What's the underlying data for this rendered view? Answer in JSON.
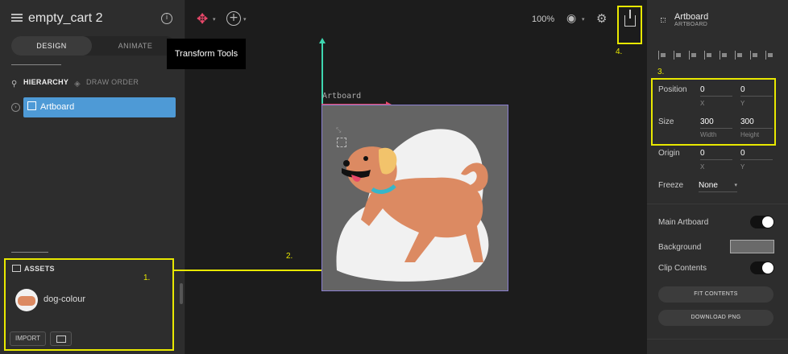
{
  "file": {
    "title": "empty_cart 2"
  },
  "modes": {
    "design": "DESIGN",
    "animate": "ANIMATE"
  },
  "left_tabs": {
    "hierarchy": "HIERARCHY",
    "draw_order": "DRAW ORDER"
  },
  "hierarchy": {
    "items": [
      {
        "label": "Artboard"
      }
    ]
  },
  "assets": {
    "header": "ASSETS",
    "items": [
      {
        "name": "dog-colour"
      }
    ],
    "import_label": "IMPORT"
  },
  "toolbar": {
    "zoom": "100%",
    "tooltip": "Transform Tools"
  },
  "canvas": {
    "artboard_label": "Artboard"
  },
  "annotations": {
    "one": "1.",
    "two": "2.",
    "three": "3.",
    "four": "4.",
    "color": "#e8e800"
  },
  "inspector": {
    "name": "Artboard",
    "type": "ARTBOARD",
    "position": {
      "label": "Position",
      "x": "0",
      "y": "0",
      "x_label": "X",
      "y_label": "Y"
    },
    "size": {
      "label": "Size",
      "width": "300",
      "height": "300",
      "width_label": "Width",
      "height_label": "Height"
    },
    "origin": {
      "label": "Origin",
      "x": "0",
      "y": "0",
      "x_label": "X",
      "y_label": "Y"
    },
    "freeze": {
      "label": "Freeze",
      "value": "None"
    },
    "main_artboard": {
      "label": "Main Artboard",
      "on": true
    },
    "background": {
      "label": "Background",
      "color": "#6a6a6a"
    },
    "clip_contents": {
      "label": "Clip Contents",
      "on": true
    },
    "fit_contents": "FIT CONTENTS",
    "download_png": "DOWNLOAD PNG"
  },
  "colors": {
    "accent": "#4e9ad6",
    "y_axis": "#3fd6b0",
    "x_axis": "#e9486a",
    "artboard_border": "#8b7fd0"
  }
}
